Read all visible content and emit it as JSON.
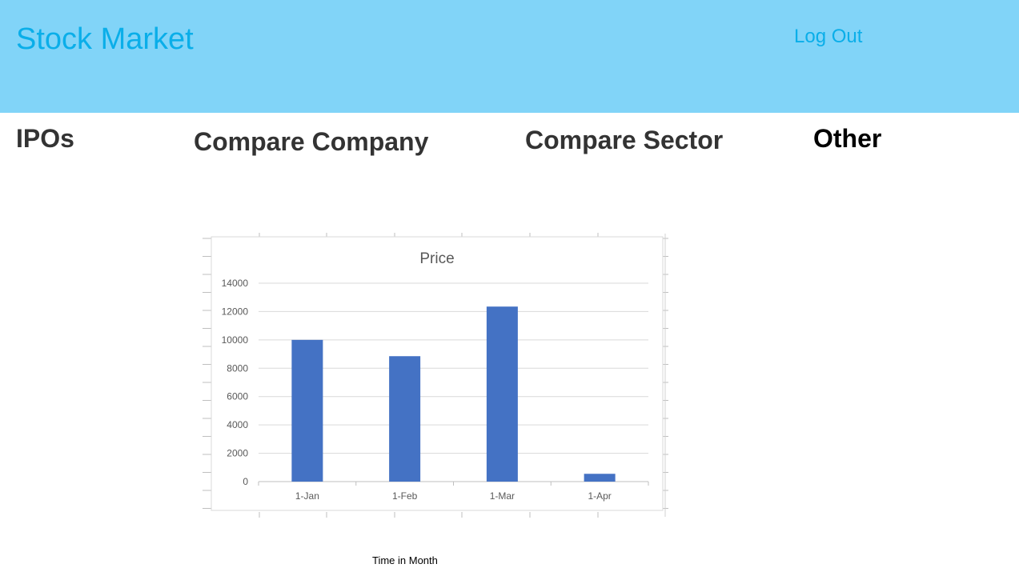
{
  "header": {
    "title": "Stock Market",
    "logout_label": "Log Out",
    "background_color": "#81d4f8",
    "accent_color": "#0aaee9"
  },
  "nav": {
    "items": [
      {
        "label": "IPOs"
      },
      {
        "label": "Compare Company"
      },
      {
        "label": "Compare Sector"
      },
      {
        "label": "Other"
      }
    ]
  },
  "chart_caption": "Time in Month",
  "chart_data": {
    "type": "bar",
    "title": "Price",
    "categories": [
      "1-Jan",
      "1-Feb",
      "1-Mar",
      "1-Apr"
    ],
    "values": [
      10000,
      8850,
      12350,
      550
    ],
    "ylim": [
      0,
      14000
    ],
    "yticks": [
      "0",
      "2000",
      "4000",
      "6000",
      "8000",
      "10000",
      "12000",
      "14000"
    ],
    "grid": true,
    "bar_color": "#4472c4",
    "grid_color": "#d9d9d9"
  }
}
